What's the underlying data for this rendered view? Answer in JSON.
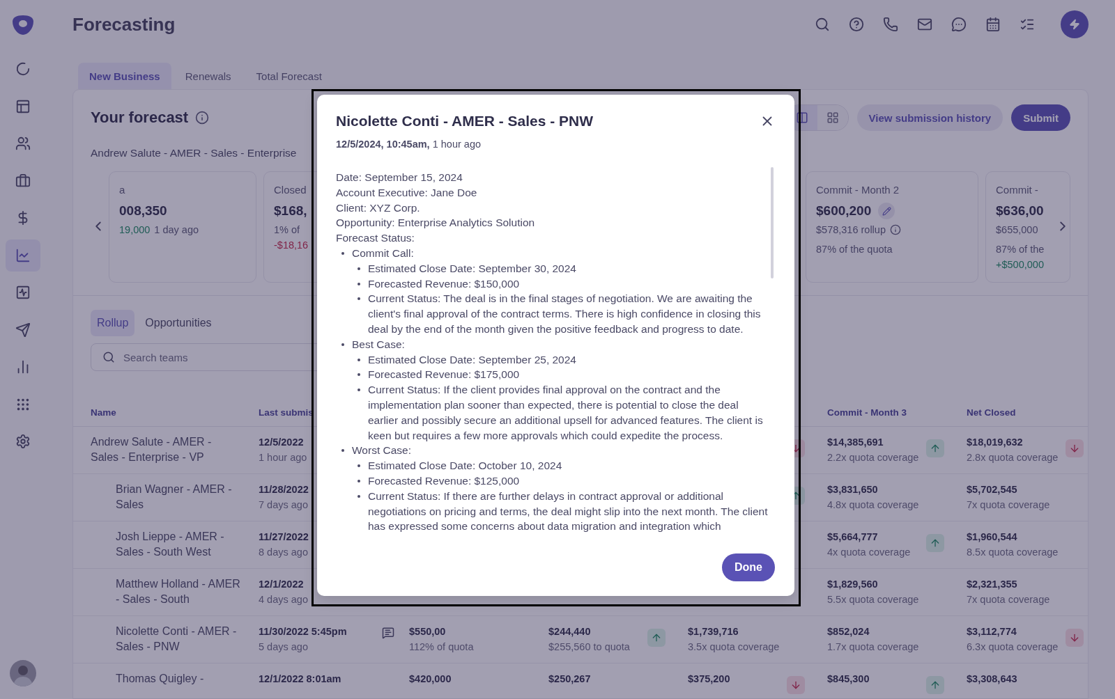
{
  "app": {
    "title": "Forecasting"
  },
  "sidebar": {
    "items": [
      {
        "selected": false
      },
      {
        "selected": false
      },
      {
        "selected": false
      },
      {
        "selected": false
      },
      {
        "selected": false
      },
      {
        "selected": true
      },
      {
        "selected": false
      },
      {
        "selected": false
      },
      {
        "selected": false
      },
      {
        "selected": false
      },
      {
        "selected": false
      }
    ]
  },
  "tabs": [
    {
      "label": "New Business",
      "selected": true
    },
    {
      "label": "Renewals",
      "selected": false
    },
    {
      "label": "Total Forecast",
      "selected": false
    }
  ],
  "forecast": {
    "title": "Your forecast",
    "subtitle": "Andrew Salute - AMER - Sales - Enterprise",
    "view_toggle": [
      {
        "selected": true
      },
      {
        "selected": false
      }
    ],
    "history_button": "View submission history",
    "submit_button": "Submit",
    "cards": [
      {
        "label": "a",
        "value": "008,350",
        "change": {
          "text": "19,000",
          "positive": true,
          "ago": "1 day ago"
        }
      },
      {
        "label": "Closed",
        "value": "$168,",
        "note": "1% of",
        "delta": {
          "text": "-$18,16",
          "positive": false
        }
      },
      {
        "label": "Commit - Month 2",
        "value": "$600,200",
        "editable": true,
        "rollup": "$578,316 rollup",
        "note": "87% of the quota"
      },
      {
        "label": "Commit -",
        "value": "$636,00",
        "rollup": "$655,000",
        "note": "87% of the",
        "delta": {
          "text": "+$500,000",
          "positive": true
        }
      }
    ]
  },
  "breakdown": {
    "tabs": [
      {
        "label": "Rollup",
        "selected": true
      },
      {
        "label": "Opportunities",
        "selected": false
      }
    ],
    "search": {
      "placeholder": "Search teams"
    },
    "columns": {
      "name": "Name",
      "last_submission": "Last submis",
      "commit_month_3": "Commit - Month 3",
      "net_closed": "Net Closed"
    },
    "rows": [
      {
        "name": "Andrew Salute - AMER - Sales - Enterprise - VP",
        "date": "12/5/2022",
        "ago": "1 hour ago",
        "comment": false,
        "column_5": {
          "increase": false
        },
        "commit_month_3": {
          "value": "$14,385,691",
          "note": "2.2x quota coverage",
          "increase": true
        },
        "net_closed": {
          "value": "$18,019,632",
          "note": "2.8x quota coverage",
          "increase": false
        },
        "children": [
          {
            "name": "Brian Wagner - AMER - Sales",
            "date": "11/28/2022",
            "ago": "7 days ago",
            "comment": false,
            "column_5": {
              "increase": true
            },
            "commit_month_3": {
              "value": "$3,831,650",
              "note": "4.8x quota coverage"
            },
            "net_closed": {
              "value": "$5,702,545",
              "note": "7x quota coverage"
            }
          },
          {
            "name": "Josh Lieppe - AMER - Sales - South West",
            "date": "11/27/2022",
            "ago": "8 days ago",
            "comment": false,
            "commit_month_3": {
              "value": "$5,664,777",
              "note": "4x quota coverage",
              "increase": true
            },
            "net_closed": {
              "value": "$1,960,544",
              "note": "8.5x quota coverage"
            }
          },
          {
            "name": "Matthew Holland - AMER - Sales - South",
            "date": "12/1/2022",
            "ago": "4 days ago",
            "comment": false,
            "commit_month_3": {
              "value": "$1,829,560",
              "note": "5.5x quota coverage"
            },
            "net_closed": {
              "value": "$2,321,355",
              "note": "7x quota coverage"
            }
          },
          {
            "name": "Nicolette Conti - AMER - Sales - PNW",
            "date": "11/30/2022 5:45pm",
            "ago": "5 days ago",
            "comment": true,
            "column_3": {
              "value": "$550,00",
              "note": "112% of quota"
            },
            "column_4": {
              "value": "$244,440",
              "note": "$255,560 to quota",
              "increase": true
            },
            "column_5": {
              "value": "$1,739,716",
              "note": "3.5x quota coverage"
            },
            "commit_month_3": {
              "value": "$852,024",
              "note": "1.7x quota coverage"
            },
            "net_closed": {
              "value": "$3,112,774",
              "note": "6.3x quota coverage",
              "increase": false
            }
          },
          {
            "name": "Thomas Quigley -",
            "date": "12/1/2022 8:01am",
            "comment": false,
            "column_3": {
              "value": "$420,000"
            },
            "column_4": {
              "value": "$250,267"
            },
            "column_5": {
              "value": "$375,200",
              "increase": false
            },
            "commit_month_3": {
              "value": "$845,300",
              "increase": true
            },
            "net_closed": {
              "value": "$3,308,643"
            }
          }
        ]
      }
    ]
  },
  "modal": {
    "title": "Nicolette Conti - AMER - Sales - PNW",
    "timestamp": "12/5/2024, 10:45am,",
    "relative_time": "1 hour ago",
    "notes": [
      {
        "text": "Date: September 15, 2024"
      },
      {
        "text": "Account Executive: Jane Doe"
      },
      {
        "text": "Client: XYZ Corp."
      },
      {
        "text": "Opportunity: Enterprise Analytics Solution"
      },
      {
        "text": "Forecast Status:",
        "children": [
          {
            "text": "Commit Call:",
            "children": [
              {
                "text": "Estimated Close Date: September 30, 2024"
              },
              {
                "text": "Forecasted Revenue: $150,000"
              },
              {
                "text": "Current Status: The deal is in the final stages of negotiation. We are awaiting the client's final approval of the contract terms. There is high confidence in closing this deal by the end of the month given the positive feedback and progress to date."
              }
            ]
          },
          {
            "text": "Best Case:",
            "children": [
              {
                "text": "Estimated Close Date: September 25, 2024"
              },
              {
                "text": "Forecasted Revenue: $175,000"
              },
              {
                "text": "Current Status: If the client provides final approval on the contract and the implementation plan sooner than expected, there is potential to close the deal earlier and possibly secure an additional upsell for advanced features. The client is keen but requires a few more approvals which could expedite the process."
              }
            ]
          },
          {
            "text": "Worst Case:",
            "children": [
              {
                "text": "Estimated Close Date: October 10, 2024"
              },
              {
                "text": "Forecasted Revenue: $125,000"
              },
              {
                "text": "Current Status: If there are further delays in contract approval or additional negotiations on pricing and terms, the deal might slip into the next month. The client has expressed some concerns about data migration and integration which"
              }
            ]
          }
        ]
      }
    ],
    "done_button": "Done"
  }
}
